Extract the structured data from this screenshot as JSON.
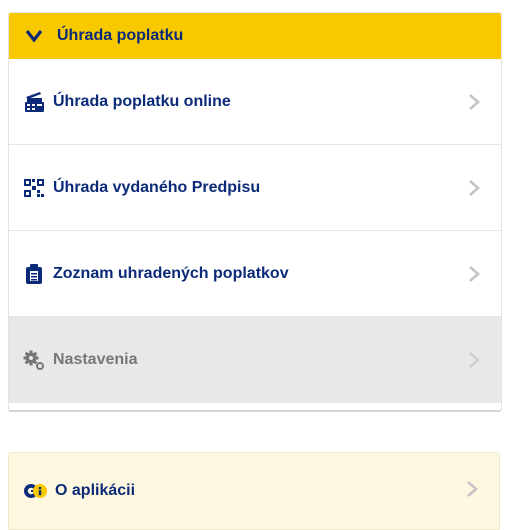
{
  "section": {
    "title": "Úhrada poplatku",
    "toggle_icon": "chevron-down-icon"
  },
  "menu": {
    "items": [
      {
        "label": "Úhrada poplatku online",
        "icon": "payment-terminal-icon"
      },
      {
        "label": "Úhrada vydaného Predpisu",
        "icon": "qr-code-icon"
      },
      {
        "label": "Zoznam uhradených poplatkov",
        "icon": "receipt-list-icon"
      },
      {
        "label": "Nastavenia",
        "icon": "gears-icon"
      }
    ]
  },
  "about": {
    "label": "O aplikácii",
    "icon": "app-info-icon"
  },
  "colors": {
    "accent": "#f9c900",
    "text": "#0b2a78",
    "muted_text": "#777777",
    "muted_bg": "#e8e8e8",
    "about_bg": "#fff8e1"
  }
}
